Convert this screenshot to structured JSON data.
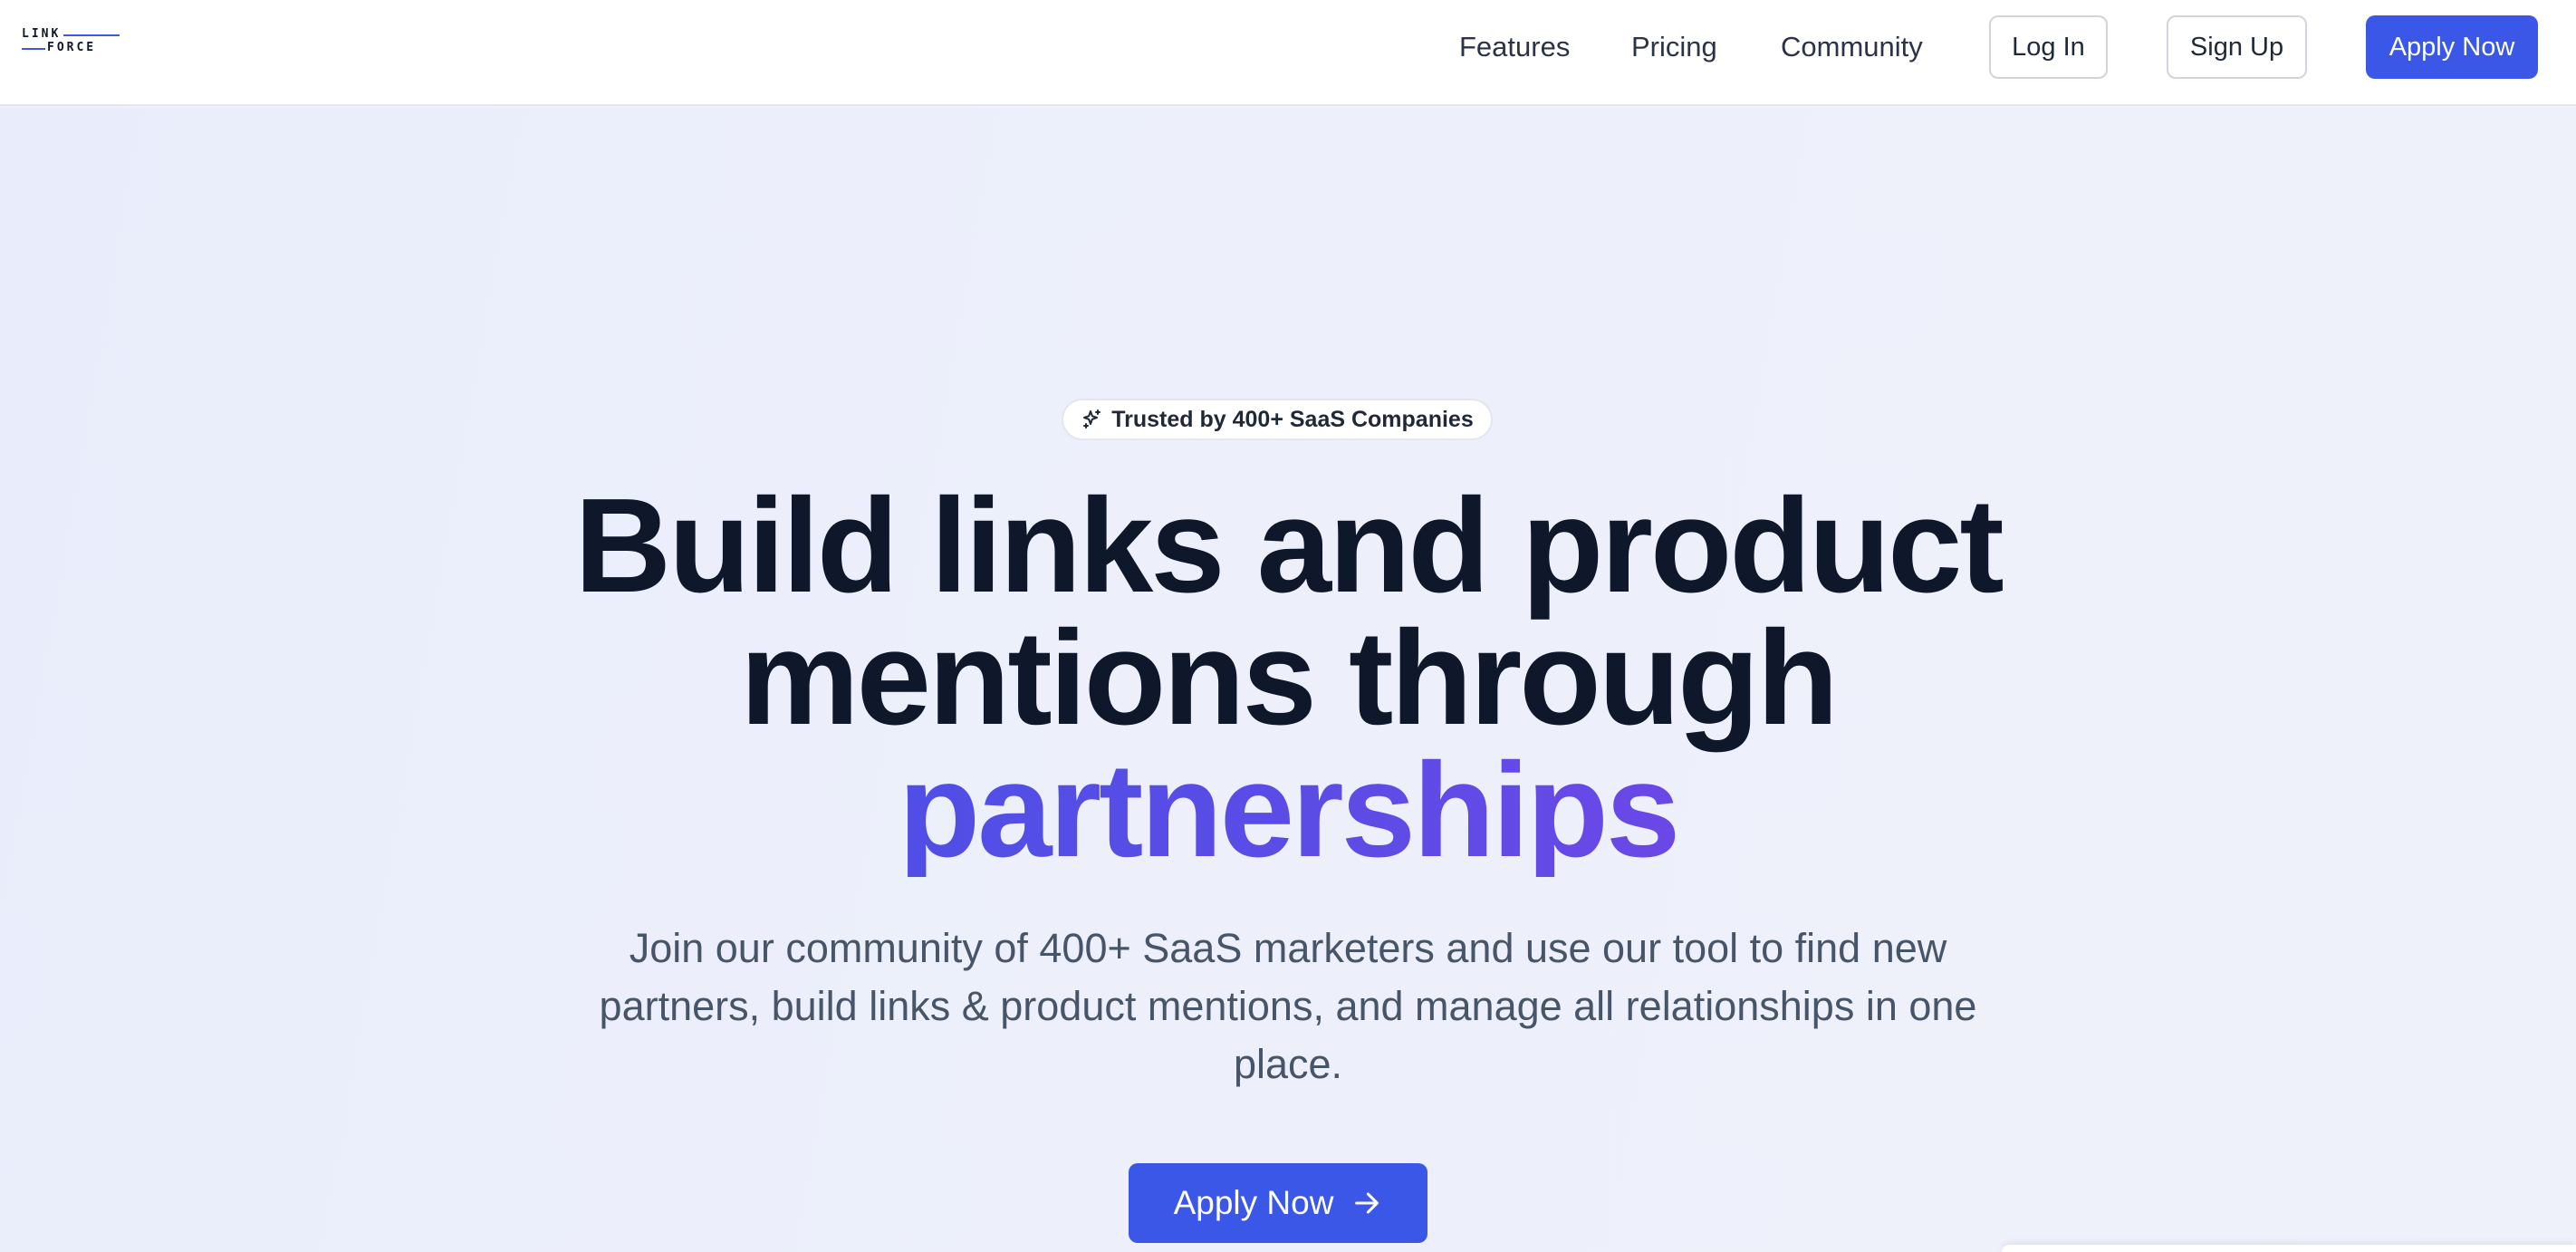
{
  "header": {
    "logo": {
      "line1": "LINK",
      "line2": "FORCE"
    },
    "nav": [
      {
        "label": "Features"
      },
      {
        "label": "Pricing"
      },
      {
        "label": "Community"
      }
    ],
    "login_label": "Log In",
    "signup_label": "Sign Up",
    "apply_label": "Apply Now"
  },
  "hero": {
    "badge": {
      "icon": "sparkles-icon",
      "text": "Trusted by 400+ SaaS Companies"
    },
    "headline": {
      "line1": "Build links and product",
      "line2": "mentions through",
      "accent": "partnerships"
    },
    "subtext": "Join our community of 400+ SaaS marketers and use our tool to find new partners, build links & product mentions, and manage all relationships in one place.",
    "cta_label": "Apply Now",
    "cta_icon": "arrow-right-icon"
  },
  "colors": {
    "primary": "#3a57e8",
    "gradient_start": "#3454e6",
    "gradient_end": "#8b3fe6",
    "heading": "#0f172a",
    "body_text": "#475569"
  }
}
